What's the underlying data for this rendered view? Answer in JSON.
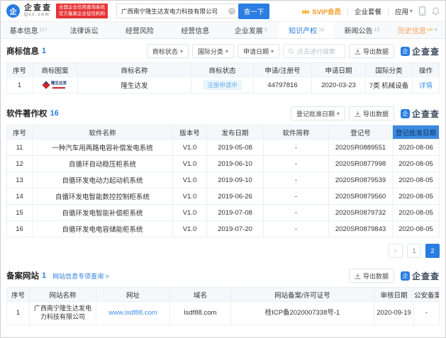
{
  "colors": {
    "accent_blue": "#2a7de1",
    "badge_red": "#e63434",
    "vip_orange": "#f5a623",
    "tag_blue_bg": "#e9f5fe",
    "tag_blue_text": "#6cb1e8",
    "table_header_bg": "#f4f8fb"
  },
  "header": {
    "logo": {
      "brand": "企查查",
      "domain": "Qcc.com",
      "badge_line1": "全国企业信用查询系统",
      "badge_line2": "官方备案企业征信机构"
    },
    "search": {
      "value": "广西南宁隆生达发电力科技有限公司",
      "button": "查一下"
    },
    "right": {
      "svip": "SVIP会员",
      "package": "企业套餐",
      "apps": "应用"
    }
  },
  "tabs": [
    {
      "label": "基本信息",
      "count": "117",
      "active": false,
      "vip": false
    },
    {
      "label": "法律诉讼",
      "count": "",
      "active": false,
      "vip": false
    },
    {
      "label": "经营风险",
      "count": "",
      "active": false,
      "vip": false
    },
    {
      "label": "经营信息",
      "count": "",
      "active": false,
      "vip": false
    },
    {
      "label": "企业发展",
      "count": "3",
      "active": false,
      "vip": false
    },
    {
      "label": "知识产权",
      "count": "18",
      "active": true,
      "vip": false
    },
    {
      "label": "新闻公告",
      "count": "13",
      "active": false,
      "vip": false
    },
    {
      "label": "历史信息",
      "count": "4",
      "active": false,
      "vip": true
    }
  ],
  "trademark_section": {
    "title": "商标信息",
    "count": "1",
    "filters": {
      "status": "商标状态",
      "intl_class": "国际分类",
      "apply_date": "申请日期"
    },
    "search_placeholder": "点击进行搜索",
    "export_label": "导出数据",
    "watermark": "企查查",
    "watermark_glyph": "企",
    "table": {
      "headers": [
        "序号",
        "商标图案",
        "商标名称",
        "商标状态",
        "申请/注册号",
        "申请日期",
        "国际分类",
        "操作"
      ],
      "row": {
        "index": "1",
        "logo_text": "隆生达发",
        "name": "隆生达发",
        "status": "注册申请中",
        "reg_no": "44797816",
        "apply_date": "2020-03-23",
        "intl_class": "7类 机械设备",
        "action": "详情"
      }
    }
  },
  "software_section": {
    "title": "软件著作权",
    "count": "16",
    "filter_date": "登记批准日期",
    "export_label": "导出数据",
    "watermark": "企查查",
    "table": {
      "headers": [
        "序号",
        "软件名称",
        "版本号",
        "发布日期",
        "软件简称",
        "登记号",
        "登记批准日期"
      ],
      "rows": [
        [
          "11",
          "一种汽车用两路电容补偿发电系统",
          "V1.0",
          "2019-05-08",
          "-",
          "2020SR0889551",
          "2020-08-06"
        ],
        [
          "12",
          "自循环自动稳压柜系统",
          "V1.0",
          "2019-06-10",
          "-",
          "2020SR0877998",
          "2020-08-05"
        ],
        [
          "13",
          "自循环发电动力起动机系统",
          "V1.0",
          "2019-09-10",
          "-",
          "2020SR0879539",
          "2020-08-05"
        ],
        [
          "14",
          "自循环发电智能数控控制柜系统",
          "V1.0",
          "2019-06-26",
          "-",
          "2020SR0879560",
          "2020-08-05"
        ],
        [
          "15",
          "自循环发电智能补偿柜系统",
          "V1.0",
          "2019-07-08",
          "-",
          "2020SR0879732",
          "2020-08-05"
        ],
        [
          "16",
          "自循环发电电容储能柜系统",
          "V1.0",
          "2019-07-20",
          "-",
          "2020SR0879843",
          "2020-08-05"
        ]
      ]
    },
    "pagination": {
      "prev": "<",
      "page1": "1",
      "page2": "2",
      "active": "2"
    }
  },
  "website_section": {
    "title": "备案网站",
    "count": "1",
    "link": "网站信息专项查询 >",
    "export_label": "导出数据",
    "watermark": "企查查",
    "table": {
      "headers": [
        "序号",
        "网站名称",
        "网址",
        "域名",
        "网站备案/许可证号",
        "审核日期",
        "公安备案"
      ],
      "row": {
        "index": "1",
        "name": "广西南宁隆生达发电力科技有限公司",
        "url": "www.lsdf88.com",
        "domain": "lsdf88.com",
        "icp": "桂ICP备2020007338号-1",
        "audit_date": "2020-09-19",
        "police_record": "-"
      }
    }
  }
}
